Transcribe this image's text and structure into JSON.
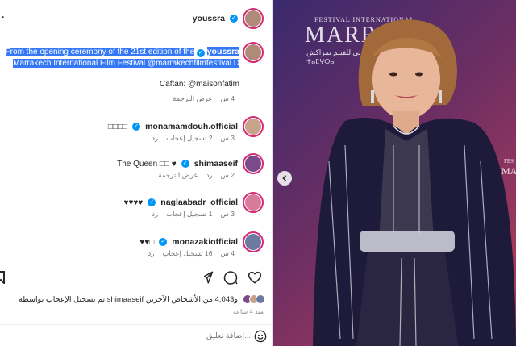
{
  "header": {
    "username": "youssra",
    "more_glyph": "·"
  },
  "caption": {
    "username": "youssra",
    "text_line1": "From the opening ceremony of the 21st edition of the",
    "text_line2": "Marrakech International Film Festival @marrakechfilmfestival D",
    "credit": "Caftan: @maisonfatim",
    "time": "4 س",
    "translate": "عرض الترجمة"
  },
  "comments": [
    {
      "username": "monamamdouh.official",
      "text": "□□□□",
      "time": "3 س",
      "likes": "2 تسجيل إعجاب",
      "reply": "رد",
      "avatar_color": "#c9a28a"
    },
    {
      "username": "shimaaseif",
      "text": "The Queen □□ ♥",
      "time": "2 س",
      "likes": "",
      "reply": "رد",
      "translate": "عرض الترجمة",
      "avatar_color": "#7a4a8a"
    },
    {
      "username": "naglaabadr_official",
      "text": "♥♥♥♥",
      "time": "3 س",
      "likes": "1 تسجيل إعجاب",
      "reply": "رد",
      "avatar_color": "#d87a9a"
    },
    {
      "username": "monazakiofficial",
      "text": "♥♥□",
      "time": "4 س",
      "likes": "16 تسجيل إعجاب",
      "reply": "رد",
      "avatar_color": "#6a7aa0"
    }
  ],
  "likes_line": "تم تسجيل الإعجاب بواسطة shimaaseif و4,043 من الأشخاص الآخرين",
  "time_ago": "منذ 4 ساعة",
  "comment_placeholder": "إضافة تعليق...",
  "photo": {
    "wall_line1": "FESTIVAL INTERNATIONAL",
    "wall_line2": "MARRA",
    "wall_arabic": "المهرجان الدولي للفيلم بمراكش",
    "wall_tifinagh": "ⵜⴰⵎⵖⵔⴰ",
    "wall_right1": "FES",
    "wall_right2": "MA"
  },
  "colors": {
    "accent": "#0095f6",
    "highlight": "#3478f6",
    "ring": "#d62976"
  }
}
